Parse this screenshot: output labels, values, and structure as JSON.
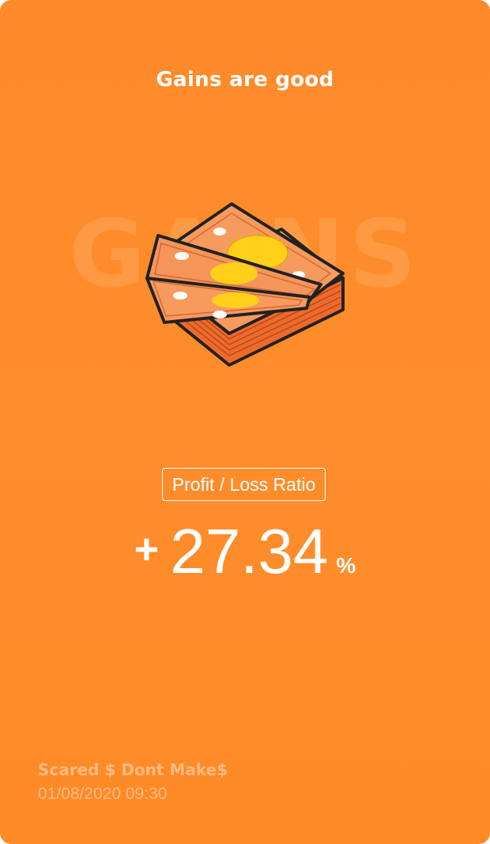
{
  "card": {
    "headline": "Gains are good",
    "watermark": "GAINS",
    "illustration": "money-stack-icon"
  },
  "ratio": {
    "label": "Profit / Loss Ratio",
    "sign": "+",
    "value": "27.34",
    "unit": "%"
  },
  "footer": {
    "name": "Scared $ Dont Make$",
    "datetime": "01/08/2020 09:30"
  },
  "colors": {
    "background": "#ff8a2a",
    "text": "#ffffff",
    "cash_body": "#f79a5e",
    "coin": "#ffcf1a",
    "outline": "#222222"
  }
}
